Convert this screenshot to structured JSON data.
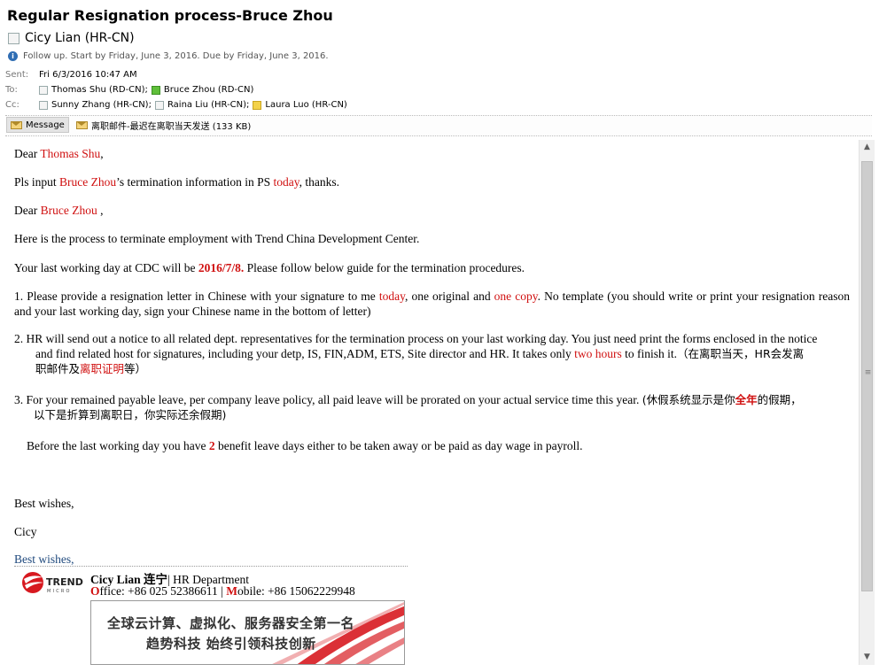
{
  "header": {
    "subject": "Regular Resignation process-Bruce Zhou",
    "sender": "Cicy Lian (HR-CN)",
    "followup": "Follow up.  Start by Friday, June 3, 2016.  Due by Friday, June 3, 2016.",
    "sent_label": "Sent:",
    "sent_value": "Fri 6/3/2016 10:47 AM",
    "to_label": "To:",
    "to": [
      "Thomas Shu (RD-CN);",
      "Bruce Zhou (RD-CN)"
    ],
    "cc_label": "Cc:",
    "cc": [
      "Sunny Zhang (HR-CN);",
      "Raina Liu (HR-CN);",
      "Laura Luo (HR-CN)"
    ]
  },
  "attachments": {
    "message_tab": "Message",
    "file": "离职邮件-最迟在离职当天发送 (133 KB)"
  },
  "body": {
    "p1": {
      "a": "Dear ",
      "b": "Thomas Shu",
      "c": ","
    },
    "p2": {
      "a": "Pls input ",
      "b": "Bruce Zhou",
      "c": "’s termination information in PS ",
      "d": "today",
      "e": ", thanks."
    },
    "p3": {
      "a": "Dear ",
      "b": "Bruce Zhou",
      "c": " ,"
    },
    "p4": "Here is the process to terminate employment with Trend China Development Center.",
    "p5": {
      "a": "Your last working day at CDC will be ",
      "b": "2016/7/8.",
      "c": " Please follow below guide for the termination procedures."
    },
    "p6": {
      "a": "1. Please provide a resignation letter in Chinese with your signature to me ",
      "b": "today",
      "c": ", one original and ",
      "d": "one copy",
      "e": ". No template (you should write or print your resignation reason and your last working day, sign your Chinese name in the bottom of letter)"
    },
    "p7": {
      "l1": "2. HR will send out a notice to all related dept. representatives for the termination process on your last working day. You just need print the forms enclosed in the notice",
      "l2a": "and find related host for signatures, including your detp, IS, FIN,ADM, ETS, Site director and HR. It takes only ",
      "l2b": "two hours",
      "l2c": " to finish it.",
      "l2d": "（在离职当天，HR会发离",
      "l3a": "职邮件及",
      "l3b": "离职证明",
      "l3c": "等）"
    },
    "p8": {
      "l1a": "3. For your remained payable leave, per company leave policy, all paid leave will be prorated on your actual service time this year. ",
      "l1b": "(休假系统显示是你",
      "l1c": "全年",
      "l1d": "的假期，",
      "l2": "以下是折算到离职日，你实际还余假期)"
    },
    "p9": {
      "a": "Before the last working day you have ",
      "b": "2",
      "c": " benefit leave days either to be taken away or be paid as day wage in payroll."
    },
    "p10": "Best wishes,",
    "p11": "Cicy"
  },
  "signature": {
    "best": "Best wishes,",
    "name": "Cicy Lian 连宁",
    "dept": "| HR Department",
    "office_o": "O",
    "office_rest": "ffice: +86 025 52386611 | ",
    "mobile_m": "M",
    "mobile_rest": "obile: +86 15062229948",
    "logo_word": "TREND",
    "logo_sub": "MICRO",
    "banner_line1": "全球云计算、虚拟化、服务器安全第一名",
    "banner_line2": "趋势科技   始终引领科技创新"
  },
  "colors": {
    "accent_red": "#d01010",
    "link_blue": "#1f497d"
  }
}
